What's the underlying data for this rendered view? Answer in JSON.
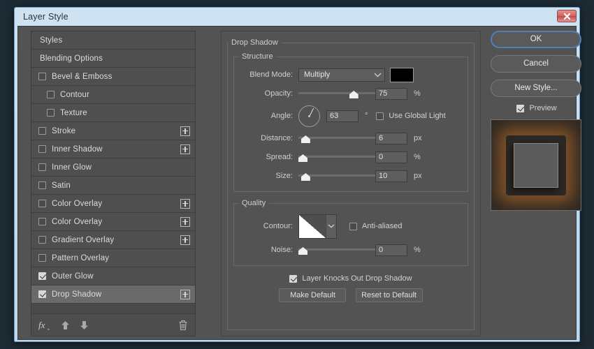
{
  "window": {
    "title": "Layer Style",
    "close_icon": "close-icon"
  },
  "styles_panel": {
    "items": [
      {
        "label": "Styles",
        "type": "plain",
        "checked": null,
        "indent": false,
        "plus": false,
        "selected": false
      },
      {
        "label": "Blending Options",
        "type": "plain",
        "checked": null,
        "indent": false,
        "plus": false,
        "selected": false
      },
      {
        "label": "Bevel & Emboss",
        "type": "check",
        "checked": false,
        "indent": false,
        "plus": false,
        "selected": false
      },
      {
        "label": "Contour",
        "type": "check",
        "checked": false,
        "indent": true,
        "plus": false,
        "selected": false
      },
      {
        "label": "Texture",
        "type": "check",
        "checked": false,
        "indent": true,
        "plus": false,
        "selected": false
      },
      {
        "label": "Stroke",
        "type": "check",
        "checked": false,
        "indent": false,
        "plus": true,
        "selected": false
      },
      {
        "label": "Inner Shadow",
        "type": "check",
        "checked": false,
        "indent": false,
        "plus": true,
        "selected": false
      },
      {
        "label": "Inner Glow",
        "type": "check",
        "checked": false,
        "indent": false,
        "plus": false,
        "selected": false
      },
      {
        "label": "Satin",
        "type": "check",
        "checked": false,
        "indent": false,
        "plus": false,
        "selected": false
      },
      {
        "label": "Color Overlay",
        "type": "check",
        "checked": false,
        "indent": false,
        "plus": true,
        "selected": false
      },
      {
        "label": "Color Overlay",
        "type": "check",
        "checked": false,
        "indent": false,
        "plus": true,
        "selected": false
      },
      {
        "label": "Gradient Overlay",
        "type": "check",
        "checked": false,
        "indent": false,
        "plus": true,
        "selected": false
      },
      {
        "label": "Pattern Overlay",
        "type": "check",
        "checked": false,
        "indent": false,
        "plus": false,
        "selected": false
      },
      {
        "label": "Outer Glow",
        "type": "check",
        "checked": true,
        "indent": false,
        "plus": false,
        "selected": false
      },
      {
        "label": "Drop Shadow",
        "type": "check",
        "checked": true,
        "indent": false,
        "plus": true,
        "selected": true
      }
    ],
    "toolbar": {
      "fx_icon": "fx-icon",
      "move_up_icon": "arrow-up-icon",
      "move_down_icon": "arrow-down-icon",
      "delete_icon": "trash-icon"
    }
  },
  "effect": {
    "title": "Drop Shadow",
    "structure": {
      "legend": "Structure",
      "blend_mode_label": "Blend Mode:",
      "blend_mode_value": "Multiply",
      "color_swatch": "#000000",
      "opacity_label": "Opacity:",
      "opacity_value": "75",
      "opacity_unit": "%",
      "opacity_percent": 75,
      "angle_label": "Angle:",
      "angle_value": "63",
      "angle_unit": "°",
      "angle_degrees": 63,
      "use_global_light_label": "Use Global Light",
      "use_global_light_checked": false,
      "distance_label": "Distance:",
      "distance_value": "6",
      "distance_unit": "px",
      "distance_percent": 4,
      "spread_label": "Spread:",
      "spread_value": "0",
      "spread_unit": "%",
      "spread_percent": 0,
      "size_label": "Size:",
      "size_value": "10",
      "size_unit": "px",
      "size_percent": 4
    },
    "quality": {
      "legend": "Quality",
      "contour_label": "Contour:",
      "contour_preset": "linear-contour",
      "anti_aliased_label": "Anti-aliased",
      "anti_aliased_checked": false,
      "noise_label": "Noise:",
      "noise_value": "0",
      "noise_unit": "%",
      "noise_percent": 0
    },
    "bottom": {
      "knockout_label": "Layer Knocks Out Drop Shadow",
      "knockout_checked": true,
      "make_default_label": "Make Default",
      "reset_default_label": "Reset to Default"
    }
  },
  "actions": {
    "ok_label": "OK",
    "cancel_label": "Cancel",
    "new_style_label": "New Style...",
    "preview_label": "Preview",
    "preview_checked": true
  },
  "colors": {
    "dialog_bg": "#535353",
    "panel_bg": "#4a4a4a",
    "selected_row": "#6a6a6a",
    "accent_focus": "#4f7fb5",
    "titlebar": "#c6dcee",
    "close_red": "#c44a46",
    "glow_orange": "#c47830"
  }
}
